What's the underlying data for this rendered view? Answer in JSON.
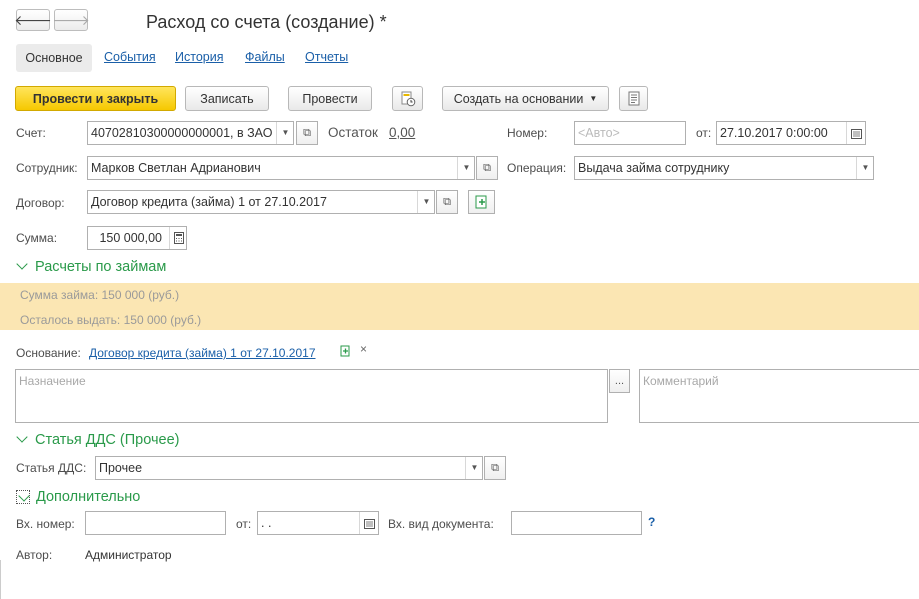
{
  "window": {
    "title": "Расход со счета (создание) *"
  },
  "nav": {
    "back": "🡐",
    "forward": "🡒"
  },
  "tabs": [
    {
      "label": "Основное"
    },
    {
      "label": "События"
    },
    {
      "label": "История"
    },
    {
      "label": "Файлы"
    },
    {
      "label": "Отчеты"
    }
  ],
  "toolbar": {
    "post_close": "Провести и закрыть",
    "save": "Записать",
    "post": "Провести",
    "create_based": "Создать на основании"
  },
  "form": {
    "account_label": "Счет:",
    "account_value": "40702810300000000001, в ЗАО",
    "balance_label": "Остаток",
    "balance_value": "0,00",
    "number_label": "Номер:",
    "number_placeholder": "<Авто>",
    "from_label": "от:",
    "date_value": "27.10.2017  0:00:00",
    "employee_label": "Сотрудник:",
    "employee_value": "Марков Светлан Адрианович",
    "operation_label": "Операция:",
    "operation_value": "Выдача займа сотруднику",
    "contract_label": "Договор:",
    "contract_value": "Договор кредита (займа) 1 от 27.10.2017",
    "sum_label": "Сумма:",
    "sum_value": "150 000,00"
  },
  "loans": {
    "title": "Расчеты по займам",
    "loan_amount": "Сумма займа: 150 000 (руб.)",
    "remaining": "Осталось выдать: 150 000 (руб.)"
  },
  "basis": {
    "label": "Основание:",
    "link": "Договор кредита (займа) 1 от 27.10.2017",
    "clear": "×"
  },
  "purpose": {
    "placeholder": "Назначение",
    "button": "..."
  },
  "comment": {
    "placeholder": "Комментарий"
  },
  "dds": {
    "title": "Статья ДДС (Прочее)",
    "label": "Статья ДДС:",
    "value": "Прочее"
  },
  "extra": {
    "title": "Дополнительно",
    "in_number_label": "Вх. номер:",
    "from_label": "от:",
    "date_placeholder": " .  .",
    "doc_type_label": "Вх. вид документа:",
    "help": "?",
    "author_label": "Автор:",
    "author_value": "Администратор"
  }
}
